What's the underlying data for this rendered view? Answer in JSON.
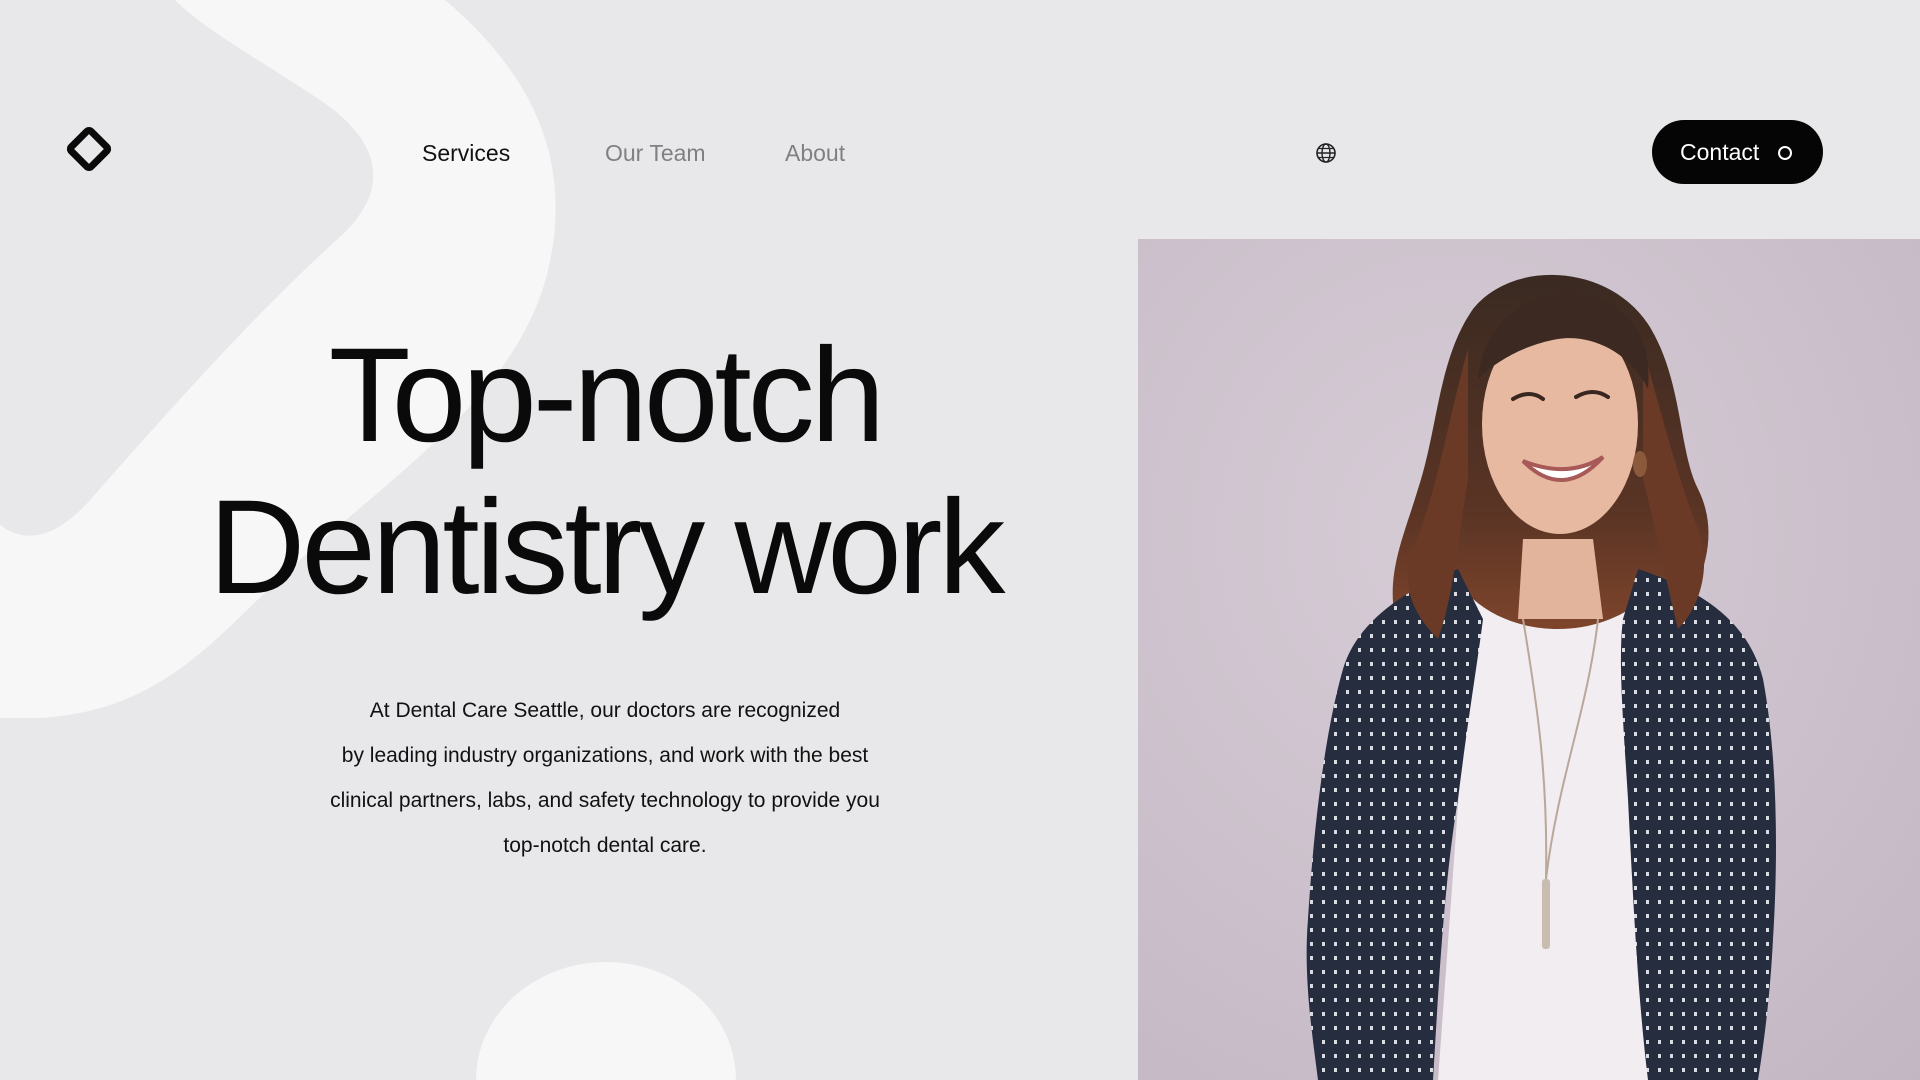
{
  "brand": {
    "logo_icon": "diamond-logo-icon"
  },
  "nav": {
    "items": [
      {
        "label": "Services",
        "active": true
      },
      {
        "label": "Our Team",
        "active": false
      },
      {
        "label": "About",
        "active": false
      }
    ],
    "language_icon": "globe-icon"
  },
  "contact": {
    "label": "Contact",
    "icon": "ring-icon"
  },
  "hero": {
    "title_lines": [
      "Top-notch",
      "Dentistry work"
    ],
    "description_lines": [
      "At Dental Care Seattle, our doctors are recognized",
      "by leading industry organizations, and work with the best",
      "clinical partners, labs, and safety technology to provide you",
      "top-notch dental care."
    ]
  },
  "photo": {
    "subject": "smiling-woman-portrait"
  },
  "colors": {
    "background": "#e8e8ea",
    "blob": "#f7f7f7",
    "text": "#0d0d0d",
    "muted_nav": "#808084",
    "button_bg": "#050505",
    "button_text": "#ffffff",
    "photo_backdrop": "#cbc0cb"
  }
}
